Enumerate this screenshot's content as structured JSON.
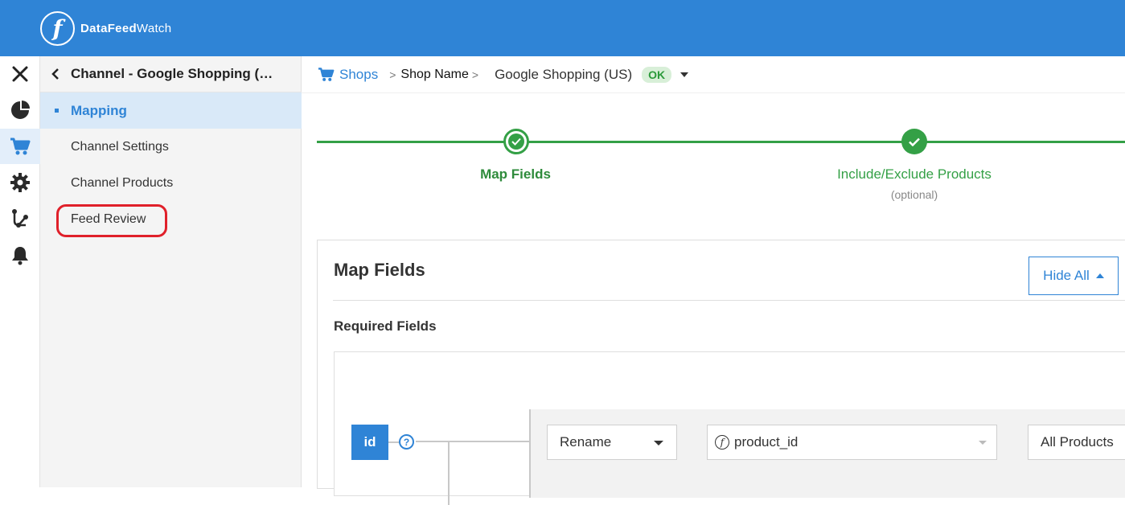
{
  "app": {
    "logo_letter": "f",
    "brand_bold": "DataFeed",
    "brand_light": "Watch"
  },
  "colors": {
    "brand_blue": "#2f84d6",
    "success_green": "#34a046",
    "highlight_red": "#e0202a"
  },
  "rail": {
    "items": [
      {
        "icon": "close-icon"
      },
      {
        "icon": "pie-chart-icon"
      },
      {
        "icon": "cart-icon",
        "active": true
      },
      {
        "icon": "gear-icon"
      },
      {
        "icon": "flow-icon"
      },
      {
        "icon": "bell-icon"
      }
    ]
  },
  "sidepanel": {
    "title": "Channel - Google Shopping (US)",
    "items": [
      {
        "label": "Mapping",
        "active": true
      },
      {
        "label": "Channel Settings"
      },
      {
        "label": "Channel Products"
      },
      {
        "label": "Feed Review",
        "highlighted": true
      }
    ]
  },
  "breadcrumb": {
    "shops": "Shops",
    "separator": ">",
    "shop_name": "Shop Name",
    "channel": "Google Shopping (US)",
    "status": "OK"
  },
  "stepper": {
    "steps": [
      {
        "label": "Map Fields",
        "current": true
      },
      {
        "label": "Include/Exclude Products",
        "sub": "(optional)"
      }
    ]
  },
  "card": {
    "title": "Map Fields",
    "hide_all": "Hide All",
    "section_title": "Required Fields",
    "field": {
      "name": "id",
      "help": "?",
      "action": "Rename",
      "source_value": "product_id",
      "scope": "All Products"
    }
  }
}
